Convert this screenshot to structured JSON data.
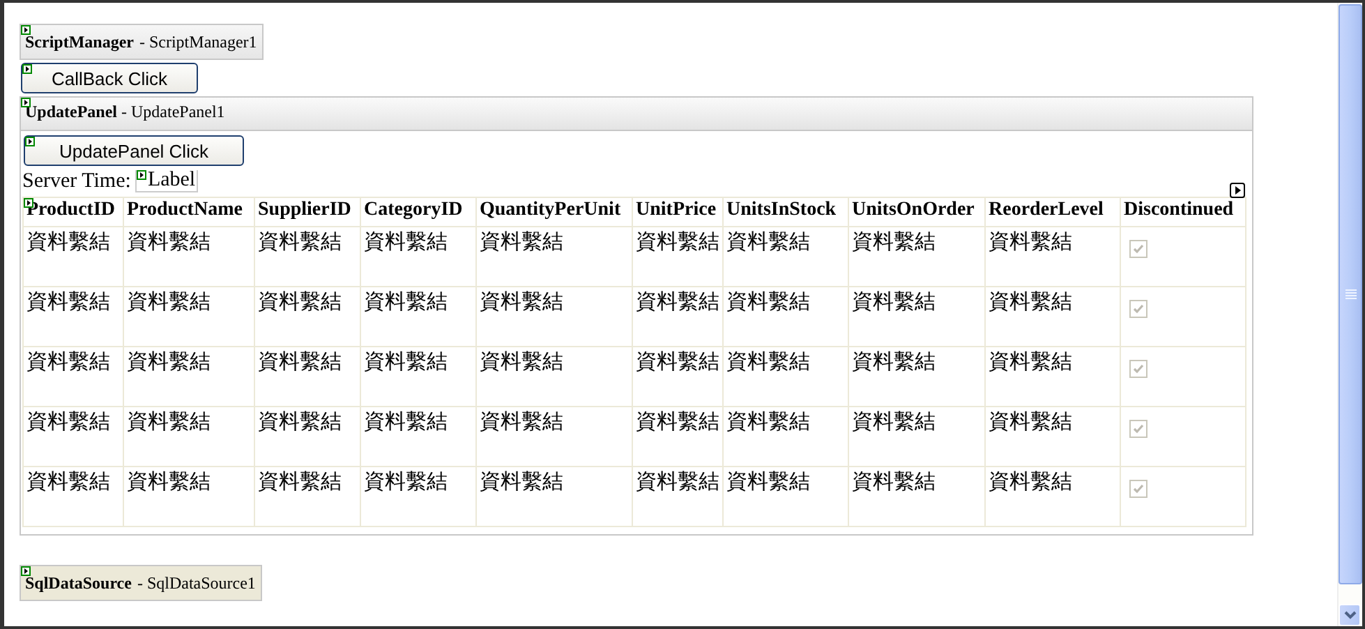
{
  "script_manager": {
    "caption": "**ScriptManager** - ScriptManager1"
  },
  "callback_button": {
    "label": "CallBack Click"
  },
  "update_panel": {
    "caption": "**UpdatePanel** - UpdatePanel1",
    "button": {
      "label": "UpdatePanel Click"
    },
    "server_time": {
      "label": "Server Time:",
      "value": "Label"
    },
    "grid": {
      "columns": [
        "ProductID",
        "ProductName",
        "SupplierID",
        "CategoryID",
        "QuantityPerUnit",
        "UnitPrice",
        "UnitsInStock",
        "UnitsOnOrder",
        "ReorderLevel",
        "Discontinued"
      ],
      "rows": [
        {
          "cells": [
            "資料繫結",
            "資料繫結",
            "資料繫結",
            "資料繫結",
            "資料繫結",
            "資料繫結",
            "資料繫結",
            "資料繫結",
            "資料繫結"
          ],
          "checked": true
        },
        {
          "cells": [
            "資料繫結",
            "資料繫結",
            "資料繫結",
            "資料繫結",
            "資料繫結",
            "資料繫結",
            "資料繫結",
            "資料繫結",
            "資料繫結"
          ],
          "checked": true
        },
        {
          "cells": [
            "資料繫結",
            "資料繫結",
            "資料繫結",
            "資料繫結",
            "資料繫結",
            "資料繫結",
            "資料繫結",
            "資料繫結",
            "資料繫結"
          ],
          "checked": true
        },
        {
          "cells": [
            "資料繫結",
            "資料繫結",
            "資料繫結",
            "資料繫結",
            "資料繫結",
            "資料繫結",
            "資料繫結",
            "資料繫結",
            "資料繫結"
          ],
          "checked": true
        },
        {
          "cells": [
            "資料繫結",
            "資料繫結",
            "資料繫結",
            "資料繫結",
            "資料繫結",
            "資料繫結",
            "資料繫結",
            "資料繫結",
            "資料繫結"
          ],
          "checked": true
        }
      ]
    }
  },
  "data_source": {
    "caption": "**SqlDataSource** - SqlDataSource1"
  }
}
